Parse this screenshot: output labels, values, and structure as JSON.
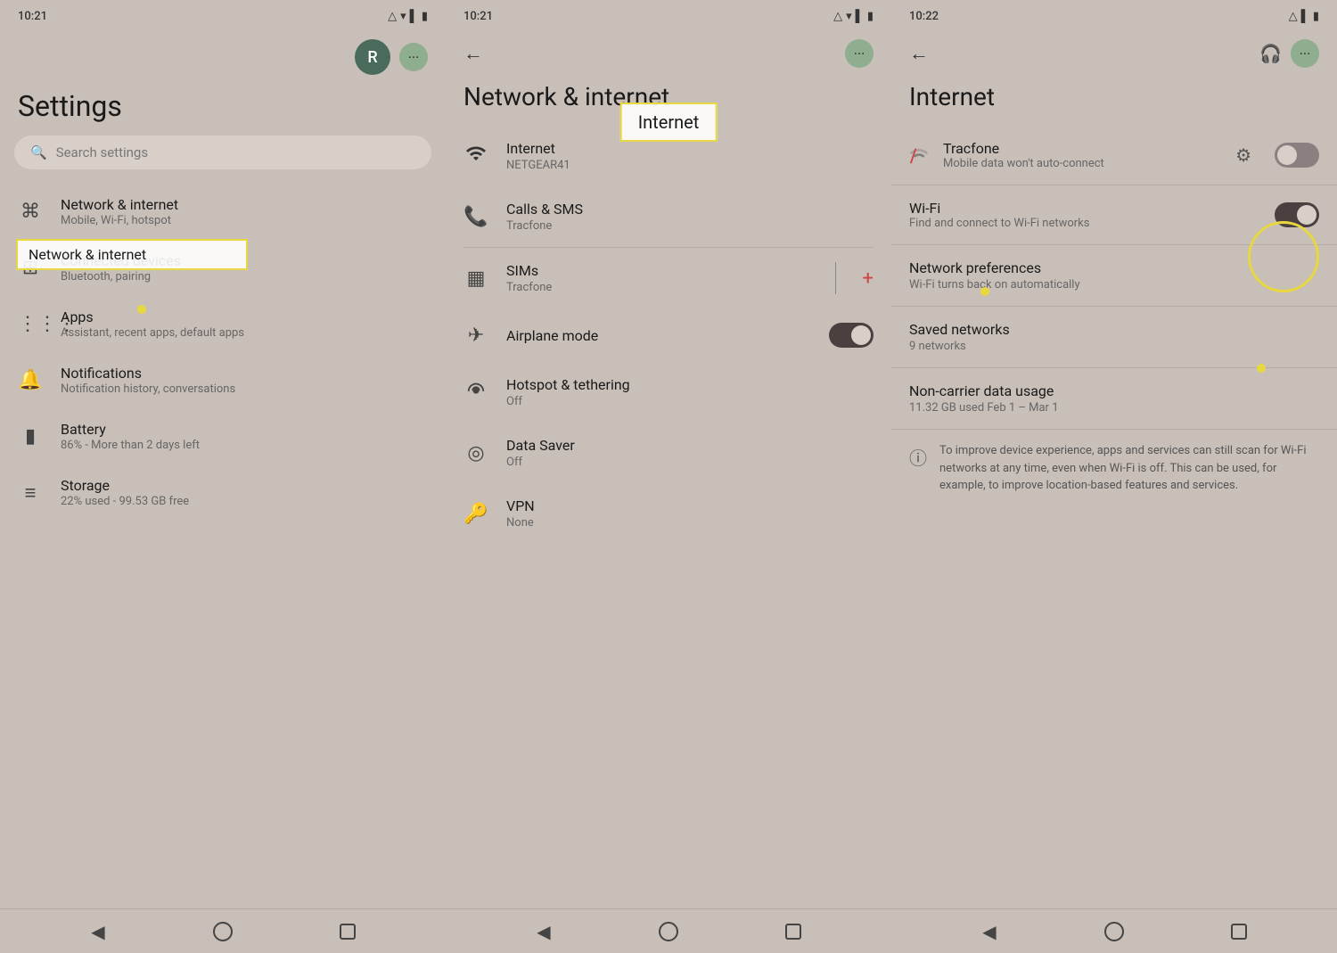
{
  "panel1": {
    "time": "10:21",
    "avatar_letter": "R",
    "page_title": "Settings",
    "search_placeholder": "Search settings",
    "annotation_label": "Network & internet",
    "items": [
      {
        "icon": "wifi",
        "title": "Network & internet",
        "subtitle": "Mobile, Wi-Fi, hotspot"
      },
      {
        "icon": "devices",
        "title": "Connected devices",
        "subtitle": "Bluetooth, pairing"
      },
      {
        "icon": "apps",
        "title": "Apps",
        "subtitle": "Assistant, recent apps, default apps"
      },
      {
        "icon": "bell",
        "title": "Notifications",
        "subtitle": "Notification history, conversations"
      },
      {
        "icon": "battery",
        "title": "Battery",
        "subtitle": "86% - More than 2 days left"
      },
      {
        "icon": "storage",
        "title": "Storage",
        "subtitle": "22% used - 99.53 GB free"
      }
    ],
    "bottom": {
      "back": "◀",
      "home": "",
      "recent": ""
    }
  },
  "panel2": {
    "time": "10:21",
    "page_title": "Network & internet",
    "annotation_label": "Internet",
    "items": [
      {
        "icon": "wifi",
        "title": "Internet",
        "subtitle": "NETGEAR41",
        "toggle": null,
        "add": null
      },
      {
        "icon": "phone",
        "title": "Calls & SMS",
        "subtitle": "Tracfone",
        "toggle": null,
        "add": null
      },
      {
        "icon": "sim",
        "title": "SIMs",
        "subtitle": "Tracfone",
        "toggle": null,
        "add": true
      },
      {
        "icon": "airplane",
        "title": "Airplane mode",
        "subtitle": "",
        "toggle": "on",
        "add": null
      },
      {
        "icon": "hotspot",
        "title": "Hotspot & tethering",
        "subtitle": "Off",
        "toggle": null,
        "add": null
      },
      {
        "icon": "datasaver",
        "title": "Data Saver",
        "subtitle": "Off",
        "toggle": null,
        "add": null
      },
      {
        "icon": "vpn",
        "title": "VPN",
        "subtitle": "None",
        "toggle": null,
        "add": null
      }
    ],
    "bottom": {
      "back": "◀",
      "home": "",
      "recent": ""
    }
  },
  "panel3": {
    "time": "10:22",
    "page_title": "Internet",
    "tracfone_title": "Tracfone",
    "tracfone_sub": "Mobile data won't auto-connect",
    "wifi_title": "Wi-Fi",
    "wifi_sub": "Find and connect to Wi-Fi networks",
    "network_pref_title": "Network preferences",
    "network_pref_sub": "Wi-Fi turns back on automatically",
    "saved_networks_title": "Saved networks",
    "saved_networks_sub": "9 networks",
    "non_carrier_title": "Non-carrier data usage",
    "non_carrier_sub": "11.32 GB used Feb 1 – Mar 1",
    "info_text": "To improve device experience, apps and services can still scan for Wi-Fi networks at any time, even when Wi-Fi is off. This can be used, for example, to improve location-based features and services.",
    "bottom": {
      "back": "◀",
      "home": "",
      "recent": ""
    }
  }
}
